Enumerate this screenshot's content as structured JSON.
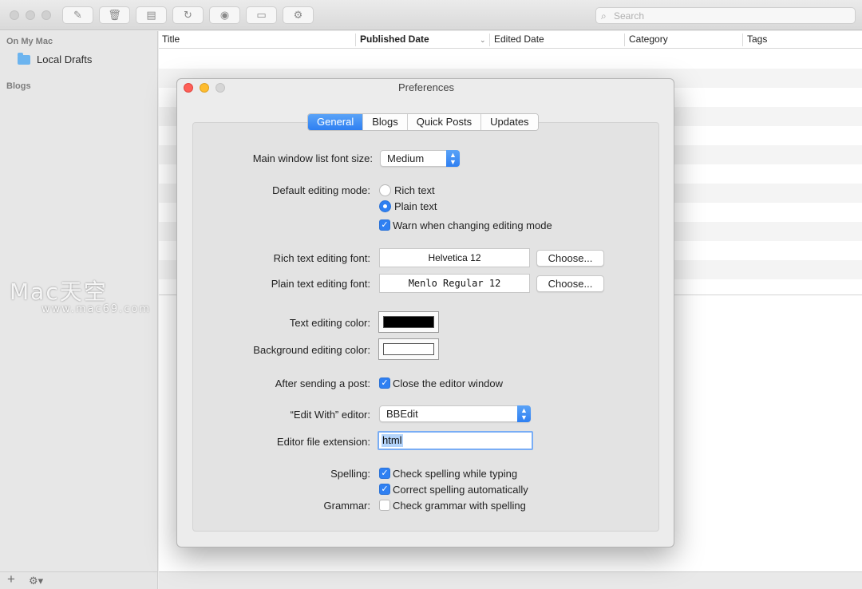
{
  "toolbar": {
    "search_placeholder": "Search"
  },
  "sidebar": {
    "header_on_my_mac": "On My Mac",
    "local_drafts": "Local Drafts",
    "header_blogs": "Blogs"
  },
  "list": {
    "columns": [
      "Title",
      "Published Date",
      "Edited Date",
      "Category",
      "Tags"
    ]
  },
  "watermark": {
    "line1": "Mac天空",
    "line2": "www.mac69.com"
  },
  "prefs": {
    "title": "Preferences",
    "tabs": [
      "General",
      "Blogs",
      "Quick Posts",
      "Updates"
    ],
    "font_size_label": "Main window list font size:",
    "font_size_value": "Medium",
    "editing_mode_label": "Default editing mode:",
    "rich_text": "Rich text",
    "plain_text": "Plain text",
    "warn_label": "Warn when changing editing mode",
    "rich_font_label": "Rich text editing font:",
    "rich_font_value": "Helvetica 12",
    "plain_font_label": "Plain text editing font:",
    "plain_font_value": "Menlo Regular 12",
    "choose": "Choose...",
    "text_color_label": "Text editing color:",
    "bg_color_label": "Background editing color:",
    "text_color": "#000000",
    "bg_color": "#ffffff",
    "after_send_label": "After sending a post:",
    "close_editor": "Close the editor window",
    "edit_with_label": "“Edit With” editor:",
    "edit_with_value": "BBEdit",
    "ext_label": "Editor file extension:",
    "ext_value": "html",
    "spelling_label": "Spelling:",
    "check_spelling": "Check spelling while typing",
    "correct_spelling": "Correct spelling automatically",
    "grammar_label": "Grammar:",
    "check_grammar": "Check grammar with spelling",
    "accent": "#2f80f2"
  }
}
